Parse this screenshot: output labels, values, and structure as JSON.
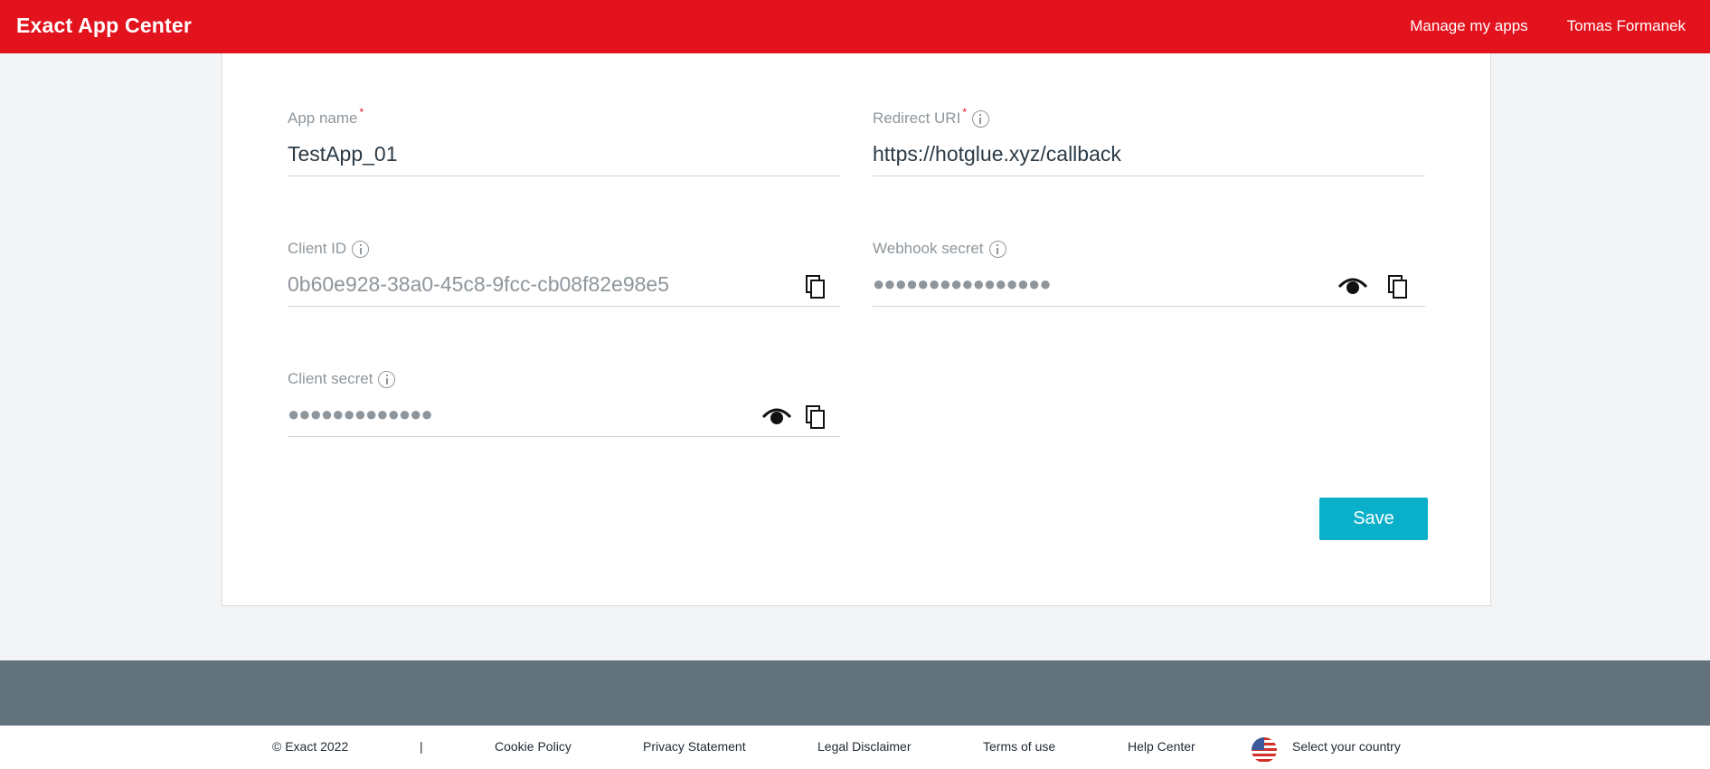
{
  "header": {
    "brand": "Exact App Center",
    "nav": {
      "manage": "Manage my apps",
      "user": "Tomas Formanek"
    }
  },
  "form": {
    "app_name": {
      "label": "App name",
      "required": "*",
      "value": "TestApp_01"
    },
    "redirect_uri": {
      "label": "Redirect URI",
      "required": "*",
      "value": "https://hotglue.xyz/callback"
    },
    "client_id": {
      "label": "Client ID",
      "value": "0b60e928-38a0-45c8-9fcc-cb08f82e98e5"
    },
    "webhook_secret": {
      "label": "Webhook secret",
      "value": "●●●●●●●●●●●●●●●●"
    },
    "client_secret": {
      "label": "Client secret",
      "value": "●●●●●●●●●●●●●"
    },
    "save_label": "Save"
  },
  "footer": {
    "copyright": "© Exact 2022",
    "separator": "|",
    "links": [
      "Cookie Policy",
      "Privacy Statement",
      "Legal Disclaimer",
      "Terms of use",
      "Help Center"
    ],
    "country": "Select your country"
  },
  "colors": {
    "brand_red": "#e3131e",
    "accent": "#0ab0c9",
    "footer_band": "#63737d"
  }
}
